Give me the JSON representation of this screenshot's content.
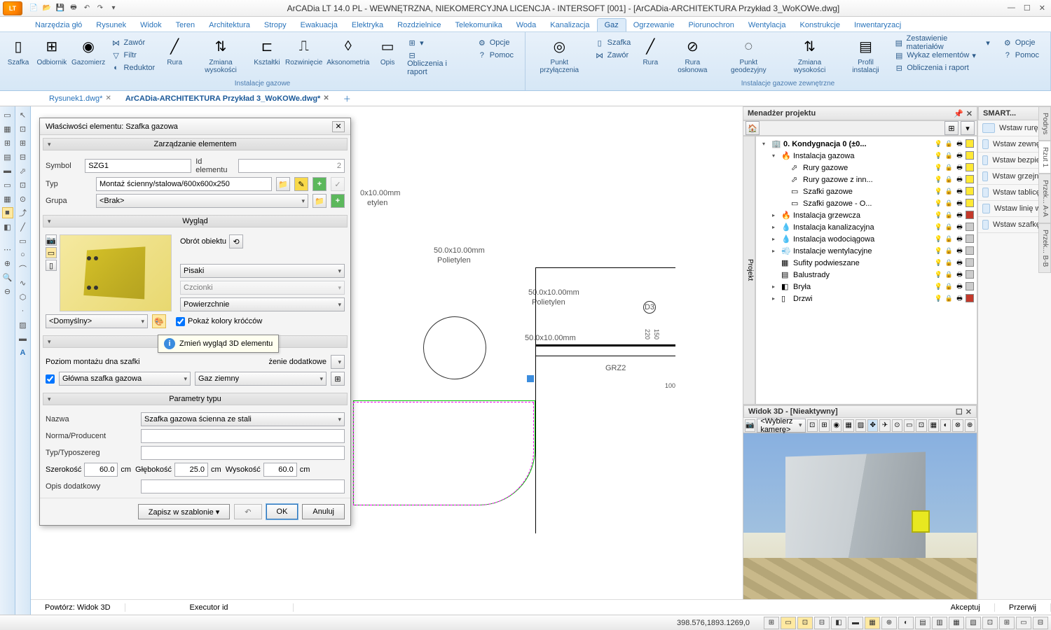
{
  "title": "ArCADia LT 14.0 PL - WEWNĘTRZNA, NIEKOMERCYJNA LICENCJA - INTERSOFT [001] - [ArCADia-ARCHITEKTURA Przykład 3_WoKOWe.dwg]",
  "app_logo_text": "LT",
  "ribbon_tabs": [
    "Narzędzia głó",
    "Rysunek",
    "Widok",
    "Teren",
    "Architektura",
    "Stropy",
    "Ewakuacja",
    "Elektryka",
    "Rozdzielnice",
    "Telekomunika",
    "Woda",
    "Kanalizacja",
    "Gaz",
    "Ogrzewanie",
    "Piorunochron",
    "Wentylacja",
    "Konstrukcje",
    "Inwentaryzacj"
  ],
  "ribbon_active": 12,
  "ribbon": {
    "group1": {
      "btns": [
        "Szafka",
        "Odbiornik",
        "Gazomierz"
      ],
      "side": [
        "Zawór",
        "Filtr",
        "Reduktor"
      ],
      "btns2": [
        "Rura",
        "Zmiana wysokości",
        "Kształtki",
        "Rozwinięcie",
        "Aksonometria",
        "Opis"
      ],
      "side2": [
        "Obliczenia i raport"
      ],
      "opcje": "Opcje",
      "pomoc": "Pomoc",
      "title": "Instalacje gazowe"
    },
    "group2": {
      "btns": [
        "Punkt przyłączenia",
        "Zawór",
        "Rura",
        "Rura osłonowa",
        "Punkt geodezyjny",
        "Zmiana wysokości",
        "Profil instalacji"
      ],
      "side_top": "Szafka",
      "side": [
        "Zestawienie materiałów",
        "Wykaz elementów",
        "Obliczenia i raport"
      ],
      "opcje": "Opcje",
      "pomoc": "Pomoc",
      "title": "Instalacje gazowe zewnętrzne"
    }
  },
  "file_tabs": [
    {
      "label": "Rysunek1.dwg*",
      "active": false
    },
    {
      "label": "ArCADia-ARCHITEKTURA Przykład 3_WoKOWe.dwg*",
      "active": true
    }
  ],
  "dialog": {
    "title": "Właściwości elementu: Szafka gazowa",
    "sec1": "Zarządzanie elementem",
    "symbol_lbl": "Symbol",
    "symbol_val": "SZG1",
    "id_lbl": "Id elementu",
    "id_val": "2",
    "typ_lbl": "Typ",
    "typ_val": "Montaż ścienny/stalowa/600x600x250",
    "grupa_lbl": "Grupa",
    "grupa_val": "<Brak>",
    "sec2": "Wygląd",
    "domyslny": "<Domyślny>",
    "pokaz_kolory": "Pokaż kolory króćców",
    "obrot": "Obrót obiektu",
    "pisaki": "Pisaki",
    "czcionki": "Czcionki",
    "powierzchnie": "Powierzchnie",
    "sec3": "Parametry",
    "poziom_lbl": "Poziom montażu dna szafki",
    "wyposazenie": "żenie dodatkowe",
    "glowna": "Główna szafka gazowa",
    "gaz_ziemny": "Gaz ziemny",
    "sec4": "Parametry typu",
    "nazwa_lbl": "Nazwa",
    "nazwa_val": "Szafka gazowa ścienna ze stali",
    "norma_lbl": "Norma/Producent",
    "typo_lbl": "Typ/Typoszereg",
    "szer_lbl": "Szerokość",
    "szer_val": "60.0",
    "gleb_lbl": "Głębokość",
    "gleb_val": "25.0",
    "wys_lbl": "Wysokość",
    "wys_val": "60.0",
    "cm": "cm",
    "opis_dod": "Opis dodatkowy",
    "zapisz": "Zapisz w szablonie",
    "ok": "OK",
    "anuluj": "Anuluj"
  },
  "tooltip": "Zmień wygląd 3D elementu",
  "project_panel": {
    "title": "Menadżer projektu",
    "side_label": "Projekt",
    "vtabs": [
      "Podrys",
      "Rzut 1",
      "Przek... A-A",
      "Przek... B-B"
    ],
    "rows": [
      {
        "ind": 0,
        "exp": "▾",
        "ico": "🏢",
        "txt": "0. Kondygnacja 0 (±0...",
        "bold": true,
        "c": "f"
      },
      {
        "ind": 1,
        "exp": "▾",
        "ico": "🔥",
        "txt": "Instalacja gazowa",
        "c": "f"
      },
      {
        "ind": 2,
        "exp": "",
        "ico": "⬀",
        "txt": "Rury gazowe",
        "c": "f"
      },
      {
        "ind": 2,
        "exp": "",
        "ico": "⬀",
        "txt": "Rury gazowe z inn...",
        "c": "f"
      },
      {
        "ind": 2,
        "exp": "",
        "ico": "▭",
        "txt": "Szafki gazowe",
        "c": "f"
      },
      {
        "ind": 2,
        "exp": "",
        "ico": "▭",
        "txt": "Szafki gazowe - O...",
        "c": "f"
      },
      {
        "ind": 1,
        "exp": "▸",
        "ico": "🔥",
        "txt": "Instalacja grzewcza",
        "c": "r"
      },
      {
        "ind": 1,
        "exp": "▸",
        "ico": "💧",
        "txt": "Instalacja kanalizacyjna",
        "c": "g"
      },
      {
        "ind": 1,
        "exp": "▸",
        "ico": "💧",
        "txt": "Instalacja wodociągowa",
        "c": "g"
      },
      {
        "ind": 1,
        "exp": "▸",
        "ico": "💨",
        "txt": "Instalacje wentylacyjne",
        "c": "g"
      },
      {
        "ind": 1,
        "exp": "",
        "ico": "▦",
        "txt": "Sufity podwieszane",
        "c": "g"
      },
      {
        "ind": 1,
        "exp": "",
        "ico": "▤",
        "txt": "Balustrady",
        "c": "g"
      },
      {
        "ind": 1,
        "exp": "▸",
        "ico": "◧",
        "txt": "Bryła",
        "c": "g"
      },
      {
        "ind": 1,
        "exp": "▸",
        "ico": "▯",
        "txt": "Drzwi",
        "c": "r"
      }
    ]
  },
  "view3d": {
    "title": "Widok 3D - [Nieaktywny]",
    "camera": "<Wybierz kamerę>"
  },
  "smart": {
    "title": "SMART...",
    "items": [
      "Wstaw rurę",
      "Wstaw zewnę...",
      "Wstaw bezpie...",
      "Wstaw grzejni...",
      "Wstaw tablicę...",
      "Wstaw linię w...",
      "Wstaw szafkę..."
    ]
  },
  "canvas_labels": {
    "l1a": "0x10.00mm",
    "l1b": "etylen",
    "l2a": "50.0x10.00mm",
    "l2b": "Polietylen",
    "l3a": "50.0x10.00mm",
    "l3b": "Polietylen",
    "l4": "50.0x10.00mm",
    "d3": "D3",
    "grz": "GRZ2",
    "n220": "220",
    "n150": "150",
    "n100": "100"
  },
  "status2": {
    "powtorz": "Powtórz: Widok 3D",
    "executor": "Executor id",
    "akceptuj": "Akceptuj",
    "przerwij": "Przerwij"
  },
  "statusbar": {
    "coords": "398.576,1893.1269,0"
  }
}
